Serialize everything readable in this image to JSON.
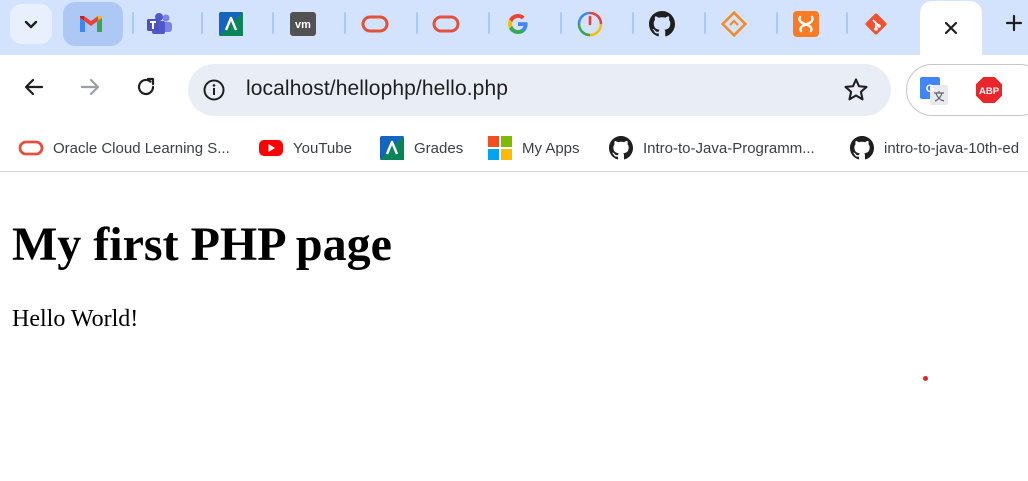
{
  "browser": {
    "tabs": [
      {
        "icon": "gmail-icon",
        "active": false
      },
      {
        "icon": "teams-icon",
        "active": false
      },
      {
        "icon": "grades-app-icon",
        "active": false
      },
      {
        "icon": "vmware-icon",
        "active": false
      },
      {
        "icon": "oracle-icon",
        "active": false
      },
      {
        "icon": "oracle-icon",
        "active": false
      },
      {
        "icon": "google-icon",
        "active": false
      },
      {
        "icon": "timer-icon",
        "active": false
      },
      {
        "icon": "github-icon",
        "active": false
      },
      {
        "icon": "sourcetree-icon",
        "active": false
      },
      {
        "icon": "xampp-icon",
        "active": false
      },
      {
        "icon": "git-icon",
        "active": false
      },
      {
        "icon": "close-icon",
        "active": true
      }
    ],
    "address_bar": {
      "url": "localhost/hellophp/hello.php"
    },
    "extensions": [
      "google-translate-icon",
      "adblock-plus-icon"
    ],
    "extension_labels": {
      "abp": "ABP"
    },
    "bookmarks": [
      {
        "label": "Oracle Cloud Learning S...",
        "icon": "oracle-icon"
      },
      {
        "label": "YouTube",
        "icon": "youtube-icon"
      },
      {
        "label": "Grades",
        "icon": "grades-app-icon"
      },
      {
        "label": "My Apps",
        "icon": "microsoft-icon"
      },
      {
        "label": "Intro-to-Java-Programm...",
        "icon": "github-icon"
      },
      {
        "label": "intro-to-java-10th-ed",
        "icon": "github-icon"
      }
    ]
  },
  "page": {
    "heading": "My first PHP page",
    "paragraph": "Hello World!"
  },
  "colors": {
    "tabstrip": "#d3e3fd",
    "omnibox": "#e9eef6",
    "oracle": "#e0513e",
    "youtube": "#ff0000"
  }
}
